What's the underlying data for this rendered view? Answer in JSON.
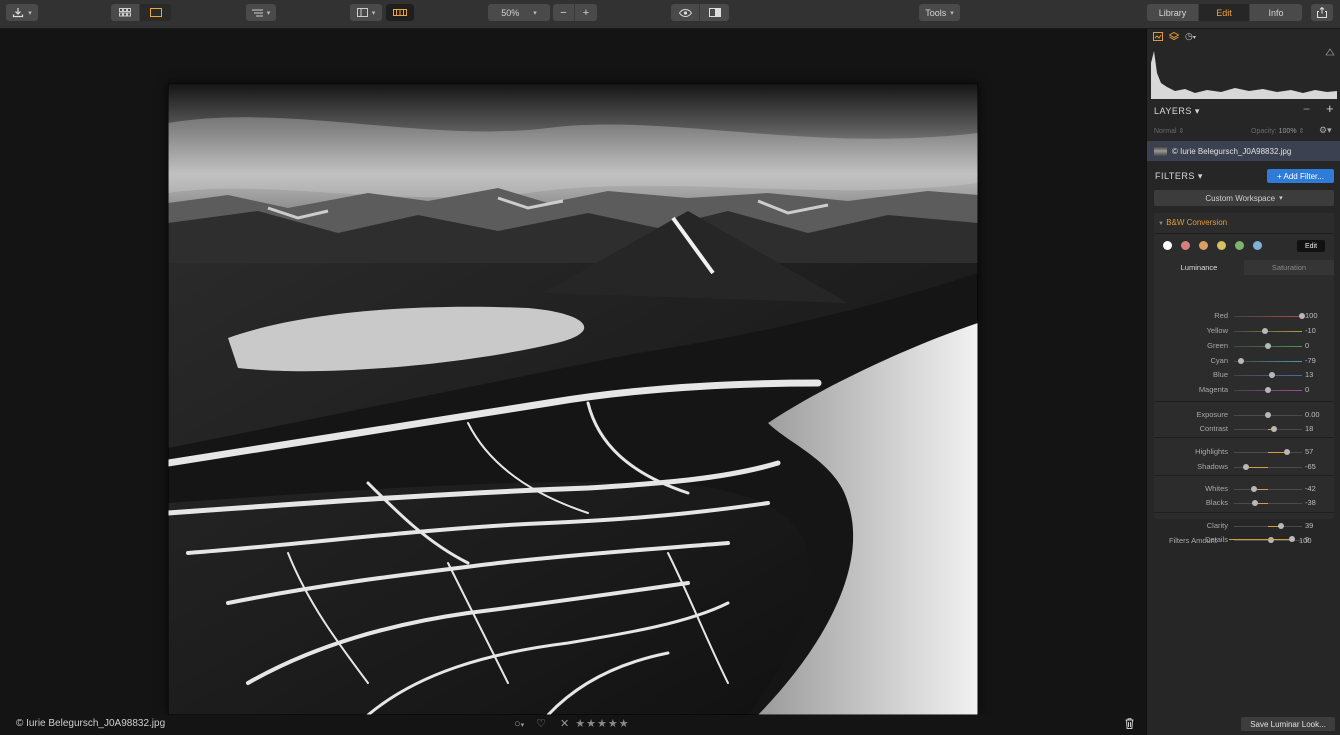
{
  "toolbar": {
    "zoom_value": "50%",
    "tools_label": "Tools",
    "tabs": [
      {
        "label": "Library",
        "active": false
      },
      {
        "label": "Edit",
        "active": true
      },
      {
        "label": "Info",
        "active": false
      }
    ]
  },
  "footer": {
    "filename": "© Iurie Belegursch_J0A98832.jpg",
    "rating_stars": "★★★★★"
  },
  "layers": {
    "title": "LAYERS",
    "blend_mode": "Normal",
    "opacity_label": "Opacity:",
    "opacity_value": "100%",
    "layer_name": "© Iurie Belegursch_J0A98832.jpg"
  },
  "filters": {
    "title": "FILTERS",
    "add_button": "+ Add Filter...",
    "workspace": "Custom Workspace",
    "bw": {
      "title": "B&W Conversion",
      "edit_label": "Edit",
      "tabs": [
        "Luminance",
        "Saturation"
      ],
      "swatches": [
        "#ffffff",
        "#d77f7a",
        "#d9a064",
        "#d6c15f",
        "#7fb26f",
        "#7fb2d9"
      ],
      "sliders": [
        {
          "label": "Red",
          "value": "100",
          "pos": 1.0,
          "color": "#b04848"
        },
        {
          "label": "Yellow",
          "value": "-10",
          "pos": 0.45,
          "color": "#b0a040"
        },
        {
          "label": "Green",
          "value": "0",
          "pos": 0.5,
          "color": "#4a9a4a"
        },
        {
          "label": "Cyan",
          "value": "-79",
          "pos": 0.105,
          "color": "#4a9aaa"
        },
        {
          "label": "Blue",
          "value": "13",
          "pos": 0.565,
          "color": "#4a6ab0"
        },
        {
          "label": "Magenta",
          "value": "0",
          "pos": 0.5,
          "color": "#a04a9a"
        },
        {
          "label": "Exposure",
          "value": "0.00",
          "pos": 0.5,
          "color": ""
        },
        {
          "label": "Contrast",
          "value": "18",
          "pos": 0.59,
          "color": "#d0a040"
        },
        {
          "label": "Highlights",
          "value": "57",
          "pos": 0.785,
          "color": "#d0a040"
        },
        {
          "label": "Shadows",
          "value": "-65",
          "pos": 0.175,
          "color": "#d0a040"
        },
        {
          "label": "Whites",
          "value": "-42",
          "pos": 0.29,
          "color": "#d0a040"
        },
        {
          "label": "Blacks",
          "value": "-38",
          "pos": 0.31,
          "color": "#d0a040"
        },
        {
          "label": "Clarity",
          "value": "39",
          "pos": 0.695,
          "color": "#d0a040"
        },
        {
          "label": "Details",
          "value": "9",
          "pos": 0.545,
          "color": "#d0a040"
        }
      ]
    },
    "amount_label": "Filters Amount",
    "amount_value": "100",
    "save_look": "Save Luminar Look..."
  }
}
